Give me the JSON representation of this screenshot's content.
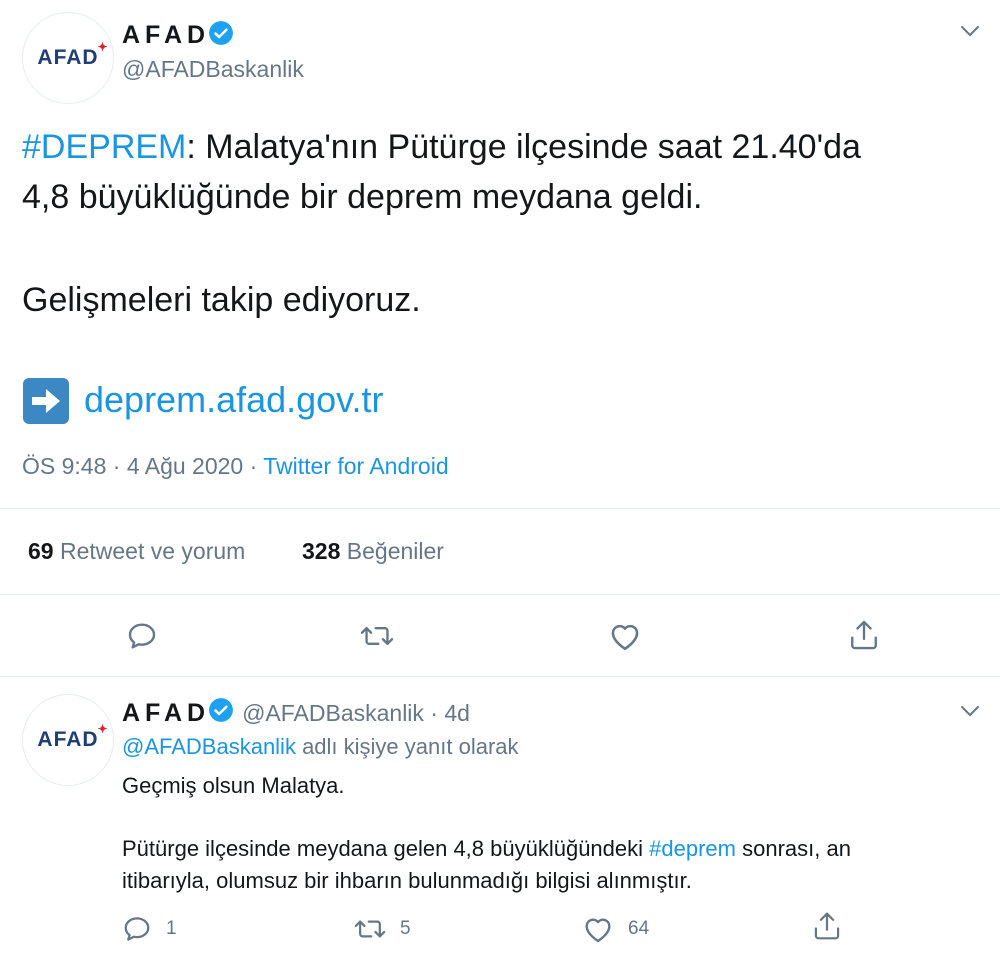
{
  "main_tweet": {
    "avatar_logo_text": "AFAD",
    "display_name": "AFAD",
    "handle": "@AFADBaskanlik",
    "hashtag": "#DEPREM",
    "text_line1_rest": ": Malatya'nın Pütürge ilçesinde saat 21.40'da",
    "text_line2": "4,8 büyüklüğünde bir deprem meydana geldi.",
    "text_para2": "Gelişmeleri takip ediyoruz.",
    "link_text": "deprem.afad.gov.tr",
    "time": "ÖS 9:48 · 4 Ağu 2020 · ",
    "source": "Twitter for Android",
    "retweets_count": "69",
    "retweets_label": " Retweet ve yorum",
    "likes_count": "328",
    "likes_label": " Beğeniler",
    "icons": [
      "reply-icon",
      "retweet-icon",
      "like-icon",
      "share-icon",
      "verified-badge-icon",
      "chevron-down-icon",
      "arrow-right-emoji-icon"
    ]
  },
  "reply_tweet": {
    "avatar_logo_text": "AFAD",
    "display_name": "AFAD",
    "handle_time": "@AFADBaskanlik · 4d",
    "replying_handle": "@AFADBaskanlik",
    "replying_suffix": " adlı kişiye yanıt olarak",
    "line1": "Geçmiş olsun Malatya.",
    "para2_part1": "Pütürge ilçesinde meydana gelen 4,8 büyüklüğündeki ",
    "para2_hashtag": "#deprem",
    "para2_part2": " sonrası, an",
    "para2_line2": "itibarıyla, olumsuz bir ihbarın bulunmadığı bilgisi alınmıştır.",
    "reply_count": "1",
    "retweet_count": "5",
    "like_count": "64"
  },
  "colors": {
    "link_blue": "#1b95e0",
    "text": "#14171a",
    "secondary": "#657786",
    "divider": "#e6ecf0",
    "verified": "#1da1f2"
  }
}
